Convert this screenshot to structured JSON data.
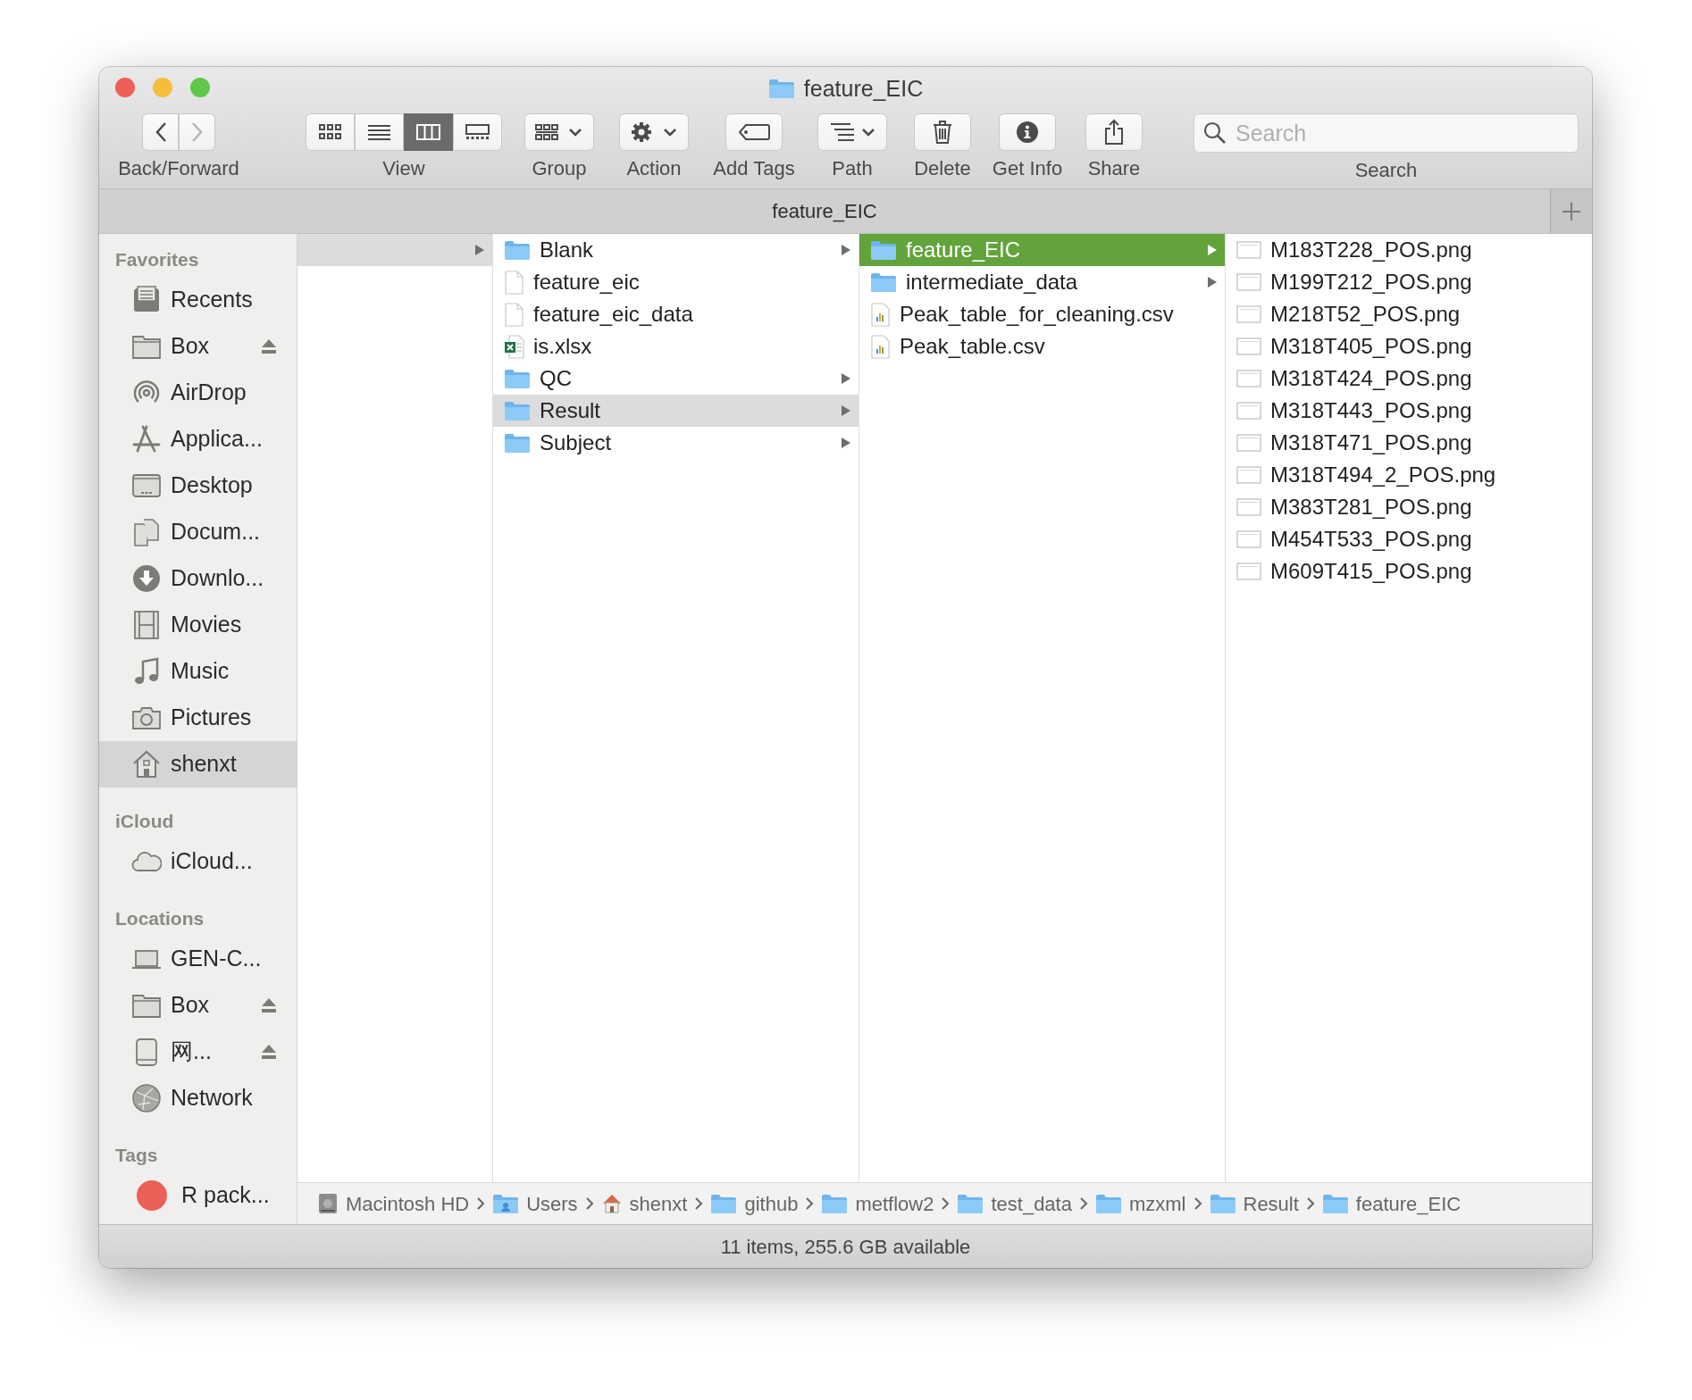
{
  "window": {
    "title": "feature_EIC"
  },
  "toolbar": [
    {
      "kind": "nav",
      "label": "Back/Forward",
      "buttons": [
        {
          "disabled": false
        },
        {
          "disabled": true
        }
      ]
    },
    {
      "kind": "view",
      "label": "View",
      "modes": [
        {
          "selected": false
        },
        {
          "selected": false
        },
        {
          "selected": true
        },
        {
          "selected": false
        }
      ]
    },
    {
      "kind": "group",
      "label": "Group"
    },
    {
      "kind": "action",
      "label": "Action"
    },
    {
      "kind": "tags",
      "label": "Add Tags"
    },
    {
      "kind": "path",
      "label": "Path"
    },
    {
      "kind": "delete",
      "label": "Delete"
    },
    {
      "kind": "info",
      "label": "Get Info"
    },
    {
      "kind": "share",
      "label": "Share"
    },
    {
      "kind": "search",
      "label": "Search",
      "placeholder": "Search"
    }
  ],
  "tab_bar": {
    "title": "feature_EIC"
  },
  "sidebar": [
    {
      "heading": "Favorites",
      "items": [
        {
          "label": "Recents",
          "kind": "recents",
          "selected": false,
          "ejectable": false
        },
        {
          "label": "Box",
          "kind": "folder",
          "selected": false,
          "ejectable": true
        },
        {
          "label": "AirDrop",
          "kind": "airdrop",
          "selected": false,
          "ejectable": false
        },
        {
          "label": "Applica...",
          "kind": "apps",
          "selected": false,
          "ejectable": false
        },
        {
          "label": "Desktop",
          "kind": "desktop",
          "selected": false,
          "ejectable": false
        },
        {
          "label": "Docum...",
          "kind": "documents",
          "selected": false,
          "ejectable": false
        },
        {
          "label": "Downlo...",
          "kind": "downloads",
          "selected": false,
          "ejectable": false
        },
        {
          "label": "Movies",
          "kind": "movies",
          "selected": false,
          "ejectable": false
        },
        {
          "label": "Music",
          "kind": "music",
          "selected": false,
          "ejectable": false
        },
        {
          "label": "Pictures",
          "kind": "pictures",
          "selected": false,
          "ejectable": false
        },
        {
          "label": "shenxt",
          "kind": "home",
          "selected": true,
          "ejectable": false
        }
      ]
    },
    {
      "heading": "iCloud",
      "items": [
        {
          "label": "iCloud...",
          "kind": "cloud",
          "selected": false,
          "ejectable": false
        }
      ]
    },
    {
      "heading": "Locations",
      "items": [
        {
          "label": "GEN-C...",
          "kind": "laptop",
          "selected": false,
          "ejectable": false
        },
        {
          "label": "Box",
          "kind": "folder",
          "selected": false,
          "ejectable": true
        },
        {
          "label": "网...",
          "kind": "drive",
          "selected": false,
          "ejectable": true
        },
        {
          "label": "Network",
          "kind": "network",
          "selected": false,
          "ejectable": false
        }
      ]
    },
    {
      "heading": "Tags",
      "items": [
        {
          "label": "R pack...",
          "kind": "tag",
          "color": "#ec5f56",
          "selected": false,
          "ejectable": false
        }
      ]
    }
  ],
  "columns": [
    {
      "items": [
        {
          "selected": false,
          "open": true,
          "expandable": true
        }
      ]
    },
    {
      "items": [
        {
          "name": "Blank",
          "kind": "folder",
          "selected": false,
          "open": false,
          "expandable": true
        },
        {
          "name": "feature_eic",
          "kind": "document",
          "selected": false,
          "open": false,
          "expandable": false
        },
        {
          "name": "feature_eic_data",
          "kind": "document",
          "selected": false,
          "open": false,
          "expandable": false
        },
        {
          "name": "is.xlsx",
          "kind": "spreadsheet",
          "selected": false,
          "open": false,
          "expandable": false
        },
        {
          "name": "QC",
          "kind": "folder",
          "selected": false,
          "open": false,
          "expandable": true
        },
        {
          "name": "Result",
          "kind": "folder",
          "selected": false,
          "open": true,
          "expandable": true
        },
        {
          "name": "Subject",
          "kind": "folder",
          "selected": false,
          "open": false,
          "expandable": true
        }
      ]
    },
    {
      "items": [
        {
          "name": "feature_EIC",
          "kind": "folder",
          "selected": true,
          "expandable": true
        },
        {
          "name": "intermediate_data",
          "kind": "folder",
          "selected": false,
          "open": false,
          "expandable": true
        },
        {
          "name": "Peak_table_for_cleaning.csv",
          "kind": "csv",
          "selected": false,
          "open": false,
          "expandable": false
        },
        {
          "name": "Peak_table.csv",
          "kind": "csv",
          "selected": false,
          "open": false,
          "expandable": false
        }
      ]
    },
    {
      "items": [
        {
          "name": "M183T228_POS.png",
          "kind": "image",
          "selected": false,
          "expandable": false
        },
        {
          "name": "M199T212_POS.png",
          "kind": "image",
          "selected": false,
          "expandable": false
        },
        {
          "name": "M218T52_POS.png",
          "kind": "image",
          "selected": false,
          "expandable": false
        },
        {
          "name": "M318T405_POS.png",
          "kind": "image",
          "selected": false,
          "expandable": false
        },
        {
          "name": "M318T424_POS.png",
          "kind": "image",
          "selected": false,
          "expandable": false
        },
        {
          "name": "M318T443_POS.png",
          "kind": "image",
          "selected": false,
          "expandable": false
        },
        {
          "name": "M318T471_POS.png",
          "kind": "image",
          "selected": false,
          "expandable": false
        },
        {
          "name": "M318T494_2_POS.png",
          "kind": "image",
          "selected": false,
          "expandable": false
        },
        {
          "name": "M383T281_POS.png",
          "kind": "image",
          "selected": false,
          "expandable": false
        },
        {
          "name": "M454T533_POS.png",
          "kind": "image",
          "selected": false,
          "expandable": false
        },
        {
          "name": "M609T415_POS.png",
          "kind": "image",
          "selected": false,
          "expandable": false
        }
      ]
    }
  ],
  "path_bar": [
    {
      "name": "Macintosh HD",
      "kind": "disk"
    },
    {
      "name": "Users",
      "kind": "users"
    },
    {
      "name": "shenxt",
      "kind": "home"
    },
    {
      "name": "github",
      "kind": "folder"
    },
    {
      "name": "metflow2",
      "kind": "folder"
    },
    {
      "name": "test_data",
      "kind": "folder"
    },
    {
      "name": "mzxml",
      "kind": "folder"
    },
    {
      "name": "Result",
      "kind": "folder"
    },
    {
      "name": "feature_EIC",
      "kind": "folder"
    }
  ],
  "status_bar": "11 items, 255.6 GB available"
}
